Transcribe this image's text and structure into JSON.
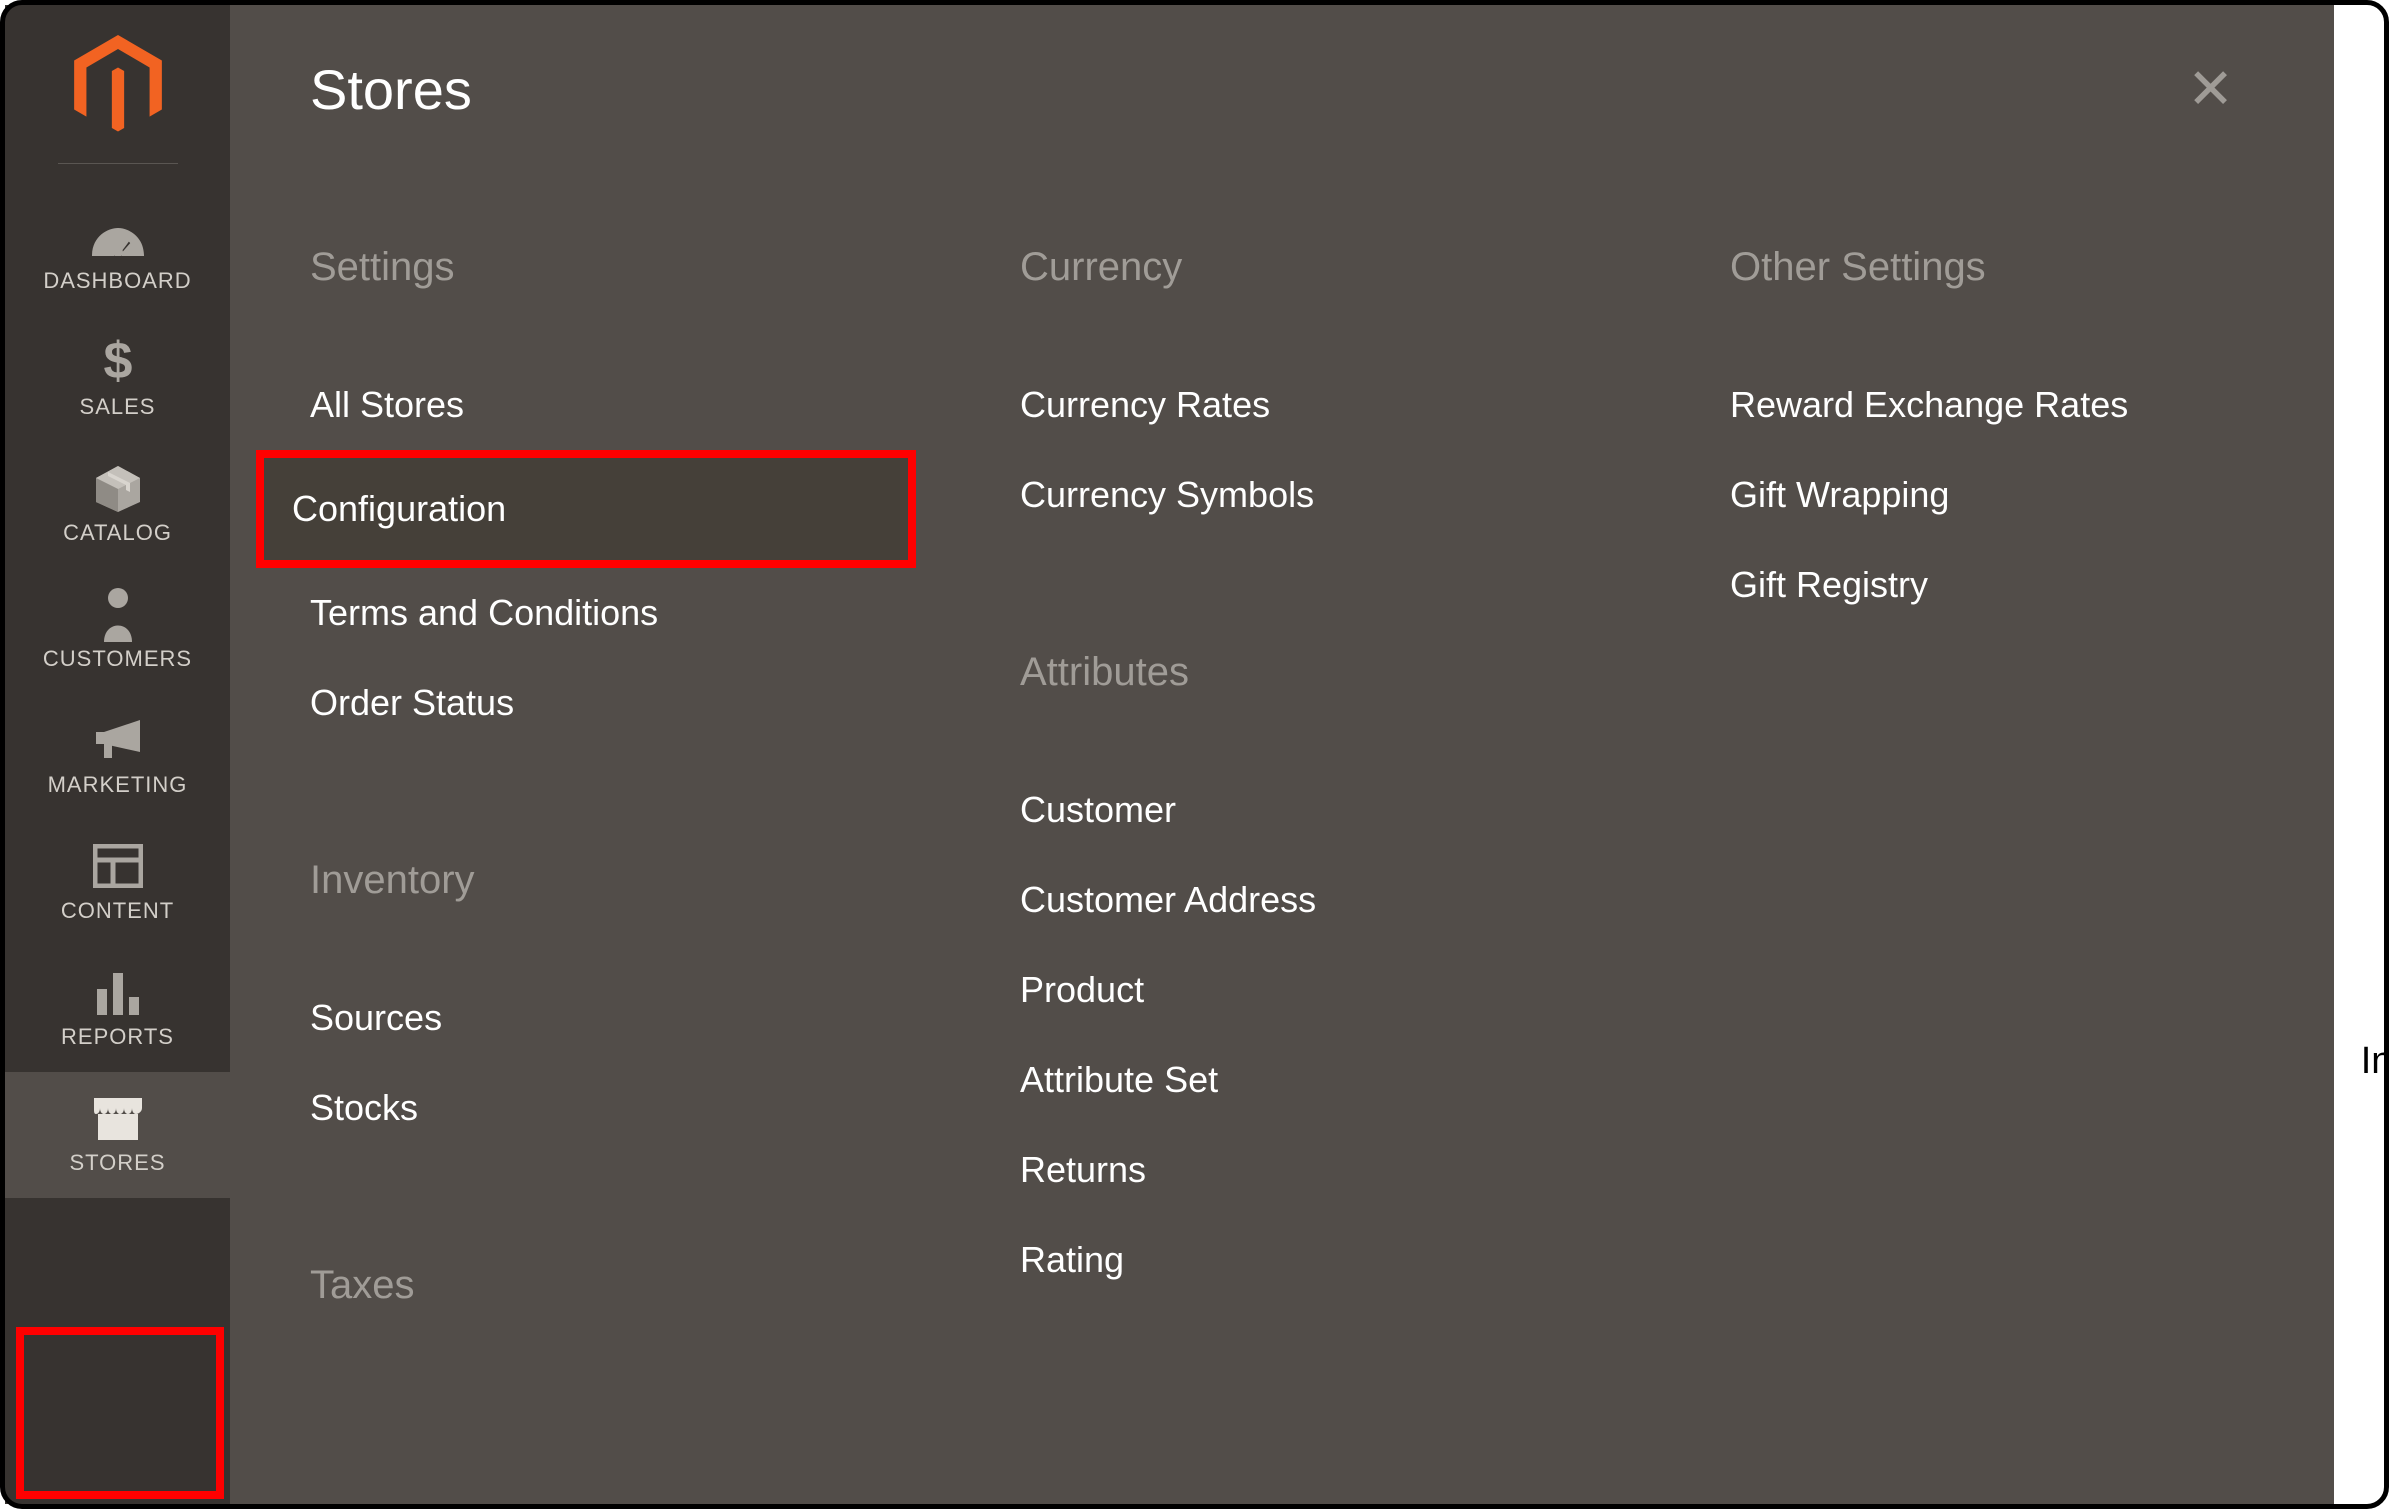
{
  "sidebar": {
    "items": [
      {
        "id": "dashboard",
        "label": "DASHBOARD"
      },
      {
        "id": "sales",
        "label": "SALES"
      },
      {
        "id": "catalog",
        "label": "CATALOG"
      },
      {
        "id": "customers",
        "label": "CUSTOMERS"
      },
      {
        "id": "marketing",
        "label": "MARKETING"
      },
      {
        "id": "content",
        "label": "CONTENT"
      },
      {
        "id": "reports",
        "label": "REPORTS"
      },
      {
        "id": "stores",
        "label": "STORES"
      }
    ]
  },
  "flyout": {
    "title": "Stores",
    "columns": [
      {
        "groups": [
          {
            "heading": "Settings",
            "items": [
              "All Stores",
              "Configuration",
              "Terms and Conditions",
              "Order Status"
            ],
            "highlighted_index": 1
          },
          {
            "heading": "Inventory",
            "items": [
              "Sources",
              "Stocks"
            ]
          },
          {
            "heading": "Taxes",
            "items": []
          }
        ]
      },
      {
        "groups": [
          {
            "heading": "Currency",
            "items": [
              "Currency Rates",
              "Currency Symbols"
            ]
          },
          {
            "heading": "Attributes",
            "items": [
              "Customer",
              "Customer Address",
              "Product",
              "Attribute Set",
              "Returns",
              "Rating"
            ]
          }
        ]
      },
      {
        "groups": [
          {
            "heading": "Other Settings",
            "items": [
              "Reward Exchange Rates",
              "Gift Wrapping",
              "Gift Registry"
            ]
          }
        ]
      }
    ]
  },
  "background_partial_text": "Inclu",
  "colors": {
    "sidebar_bg": "#373330",
    "flyout_bg": "#524d49",
    "highlight_border": "#ff0000",
    "accent": "#f26322"
  }
}
